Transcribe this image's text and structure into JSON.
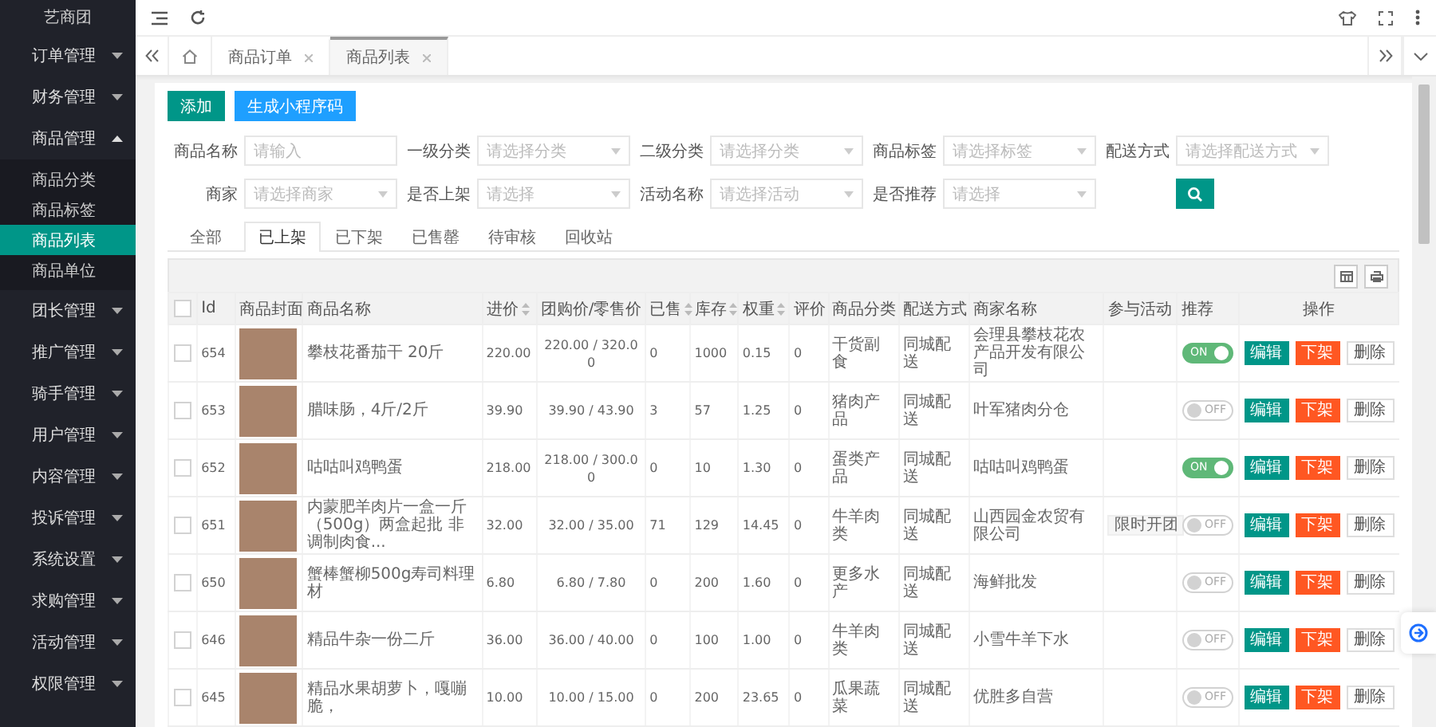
{
  "sidebar": {
    "logo": "艺商团",
    "items": [
      {
        "label": "订单管理",
        "expanded": false
      },
      {
        "label": "财务管理",
        "expanded": false
      },
      {
        "label": "商品管理",
        "expanded": true,
        "children": [
          {
            "label": "商品分类",
            "selected": false
          },
          {
            "label": "商品标签",
            "selected": false
          },
          {
            "label": "商品列表",
            "selected": true
          },
          {
            "label": "商品单位",
            "selected": false
          }
        ]
      },
      {
        "label": "团长管理",
        "expanded": false
      },
      {
        "label": "推广管理",
        "expanded": false
      },
      {
        "label": "骑手管理",
        "expanded": false
      },
      {
        "label": "用户管理",
        "expanded": false
      },
      {
        "label": "内容管理",
        "expanded": false
      },
      {
        "label": "投诉管理",
        "expanded": false
      },
      {
        "label": "系统设置",
        "expanded": false
      },
      {
        "label": "求购管理",
        "expanded": false
      },
      {
        "label": "活动管理",
        "expanded": false
      },
      {
        "label": "权限管理",
        "expanded": false
      }
    ]
  },
  "tabs": [
    {
      "label": "商品订单",
      "selected": false
    },
    {
      "label": "商品列表",
      "selected": true
    }
  ],
  "actions": [
    {
      "label": "添加",
      "kind": "primary"
    },
    {
      "label": "生成小程序码",
      "kind": "info"
    }
  ],
  "filters": [
    {
      "label": "商品名称",
      "placeholder": "请输入",
      "kind": "input"
    },
    {
      "label": "一级分类",
      "placeholder": "请选择分类",
      "kind": "select"
    },
    {
      "label": "二级分类",
      "placeholder": "请选择分类",
      "kind": "select"
    },
    {
      "label": "商品标签",
      "placeholder": "请选择标签",
      "kind": "select"
    },
    {
      "label": "配送方式",
      "placeholder": "请选择配送方式",
      "kind": "select"
    },
    {
      "label": "商家",
      "placeholder": "请选择商家",
      "kind": "select"
    },
    {
      "label": "是否上架",
      "placeholder": "请选择",
      "kind": "select"
    },
    {
      "label": "活动名称",
      "placeholder": "请选择活动",
      "kind": "select"
    },
    {
      "label": "是否推荐",
      "placeholder": "请选择",
      "kind": "select"
    }
  ],
  "status_tabs": [
    {
      "label": "全部",
      "selected": false
    },
    {
      "label": "已上架",
      "selected": true
    },
    {
      "label": "已下架",
      "selected": false
    },
    {
      "label": "已售罄",
      "selected": false
    },
    {
      "label": "待审核",
      "selected": false
    },
    {
      "label": "回收站",
      "selected": false
    }
  ],
  "table": {
    "select_all_checked": false,
    "columns": [
      {
        "label": "Id",
        "sortable": false
      },
      {
        "label": "商品封面",
        "sortable": false
      },
      {
        "label": "商品名称",
        "sortable": false
      },
      {
        "label": "进价",
        "sortable": true
      },
      {
        "label": "团购价/零售价",
        "sortable": false
      },
      {
        "label": "已售",
        "sortable": true
      },
      {
        "label": "库存",
        "sortable": true
      },
      {
        "label": "权重",
        "sortable": true
      },
      {
        "label": "评价",
        "sortable": false
      },
      {
        "label": "商品分类",
        "sortable": false
      },
      {
        "label": "配送方式",
        "sortable": false
      },
      {
        "label": "商家名称",
        "sortable": false
      },
      {
        "label": "参与活动",
        "sortable": false
      },
      {
        "label": "推荐",
        "sortable": false
      },
      {
        "label": "操作",
        "sortable": false
      }
    ],
    "rows": [
      {
        "id": "654",
        "name": "攀枝花番茄干 20斤",
        "cost": "220.00",
        "price": "220.00 / 320.00",
        "sold": "0",
        "stock": "1000",
        "weight": "0.15",
        "rating": "0",
        "category": "干货副食",
        "delivery": "同城配送",
        "merchant": "会理县攀枝花农产品开发有限公司",
        "checked": false,
        "recommend": {
          "on": true,
          "label": "ON"
        },
        "actions": [
          {
            "label": "编辑",
            "kind": "edit"
          },
          {
            "label": "下架",
            "kind": "off"
          },
          {
            "label": "删除",
            "kind": "delete"
          }
        ]
      },
      {
        "id": "653",
        "name": "腊味肠，4斤/2斤",
        "cost": "39.90",
        "price": "39.90 / 43.90",
        "sold": "3",
        "stock": "57",
        "weight": "1.25",
        "rating": "0",
        "category": "猪肉产品",
        "delivery": "同城配送",
        "merchant": "叶军猪肉分仓",
        "checked": false,
        "recommend": {
          "on": false,
          "label": "OFF"
        },
        "actions": [
          {
            "label": "编辑",
            "kind": "edit"
          },
          {
            "label": "下架",
            "kind": "off"
          },
          {
            "label": "删除",
            "kind": "delete"
          }
        ]
      },
      {
        "id": "652",
        "name": "咕咕叫鸡鸭蛋",
        "cost": "218.00",
        "price": "218.00 / 300.00",
        "sold": "0",
        "stock": "10",
        "weight": "1.30",
        "rating": "0",
        "category": "蛋类产品",
        "delivery": "同城配送",
        "merchant": "咕咕叫鸡鸭蛋",
        "checked": false,
        "recommend": {
          "on": true,
          "label": "ON"
        },
        "actions": [
          {
            "label": "编辑",
            "kind": "edit"
          },
          {
            "label": "下架",
            "kind": "off"
          },
          {
            "label": "删除",
            "kind": "delete"
          }
        ]
      },
      {
        "id": "651",
        "name": "内蒙肥羊肉片一盒一斤（500g）两盒起批 非调制肉食...",
        "cost": "32.00",
        "price": "32.00 / 35.00",
        "sold": "71",
        "stock": "129",
        "weight": "14.45",
        "rating": "0",
        "category": "牛羊肉类",
        "delivery": "同城配送",
        "merchant": "山西园金农贸有限公司",
        "activity": "限时开团",
        "checked": false,
        "recommend": {
          "on": false,
          "label": "OFF"
        },
        "actions": [
          {
            "label": "编辑",
            "kind": "edit"
          },
          {
            "label": "下架",
            "kind": "off"
          },
          {
            "label": "删除",
            "kind": "delete"
          }
        ]
      },
      {
        "id": "650",
        "name": "蟹棒蟹柳500g寿司料理材",
        "cost": "6.80",
        "price": "6.80 / 7.80",
        "sold": "0",
        "stock": "200",
        "weight": "1.60",
        "rating": "0",
        "category": "更多水产",
        "delivery": "同城配送",
        "merchant": "海鲜批发",
        "checked": false,
        "recommend": {
          "on": false,
          "label": "OFF"
        },
        "actions": [
          {
            "label": "编辑",
            "kind": "edit"
          },
          {
            "label": "下架",
            "kind": "off"
          },
          {
            "label": "删除",
            "kind": "delete"
          }
        ]
      },
      {
        "id": "646",
        "name": "精品牛杂一份二斤",
        "cost": "36.00",
        "price": "36.00 / 40.00",
        "sold": "0",
        "stock": "100",
        "weight": "1.00",
        "rating": "0",
        "category": "牛羊肉类",
        "delivery": "同城配送",
        "merchant": "小雪牛羊下水",
        "checked": false,
        "recommend": {
          "on": false,
          "label": "OFF"
        },
        "actions": [
          {
            "label": "编辑",
            "kind": "edit"
          },
          {
            "label": "下架",
            "kind": "off"
          },
          {
            "label": "删除",
            "kind": "delete"
          }
        ]
      },
      {
        "id": "645",
        "name": "精品水果胡萝卜，嘎嘣脆，",
        "cost": "10.00",
        "price": "10.00 / 15.00",
        "sold": "0",
        "stock": "200",
        "weight": "23.65",
        "rating": "0",
        "category": "瓜果蔬菜",
        "delivery": "同城配送",
        "merchant": "优胜多自营",
        "checked": false,
        "recommend": {
          "on": false,
          "label": "OFF"
        },
        "actions": [
          {
            "label": "编辑",
            "kind": "edit"
          },
          {
            "label": "下架",
            "kind": "off"
          },
          {
            "label": "删除",
            "kind": "delete"
          }
        ]
      }
    ]
  }
}
